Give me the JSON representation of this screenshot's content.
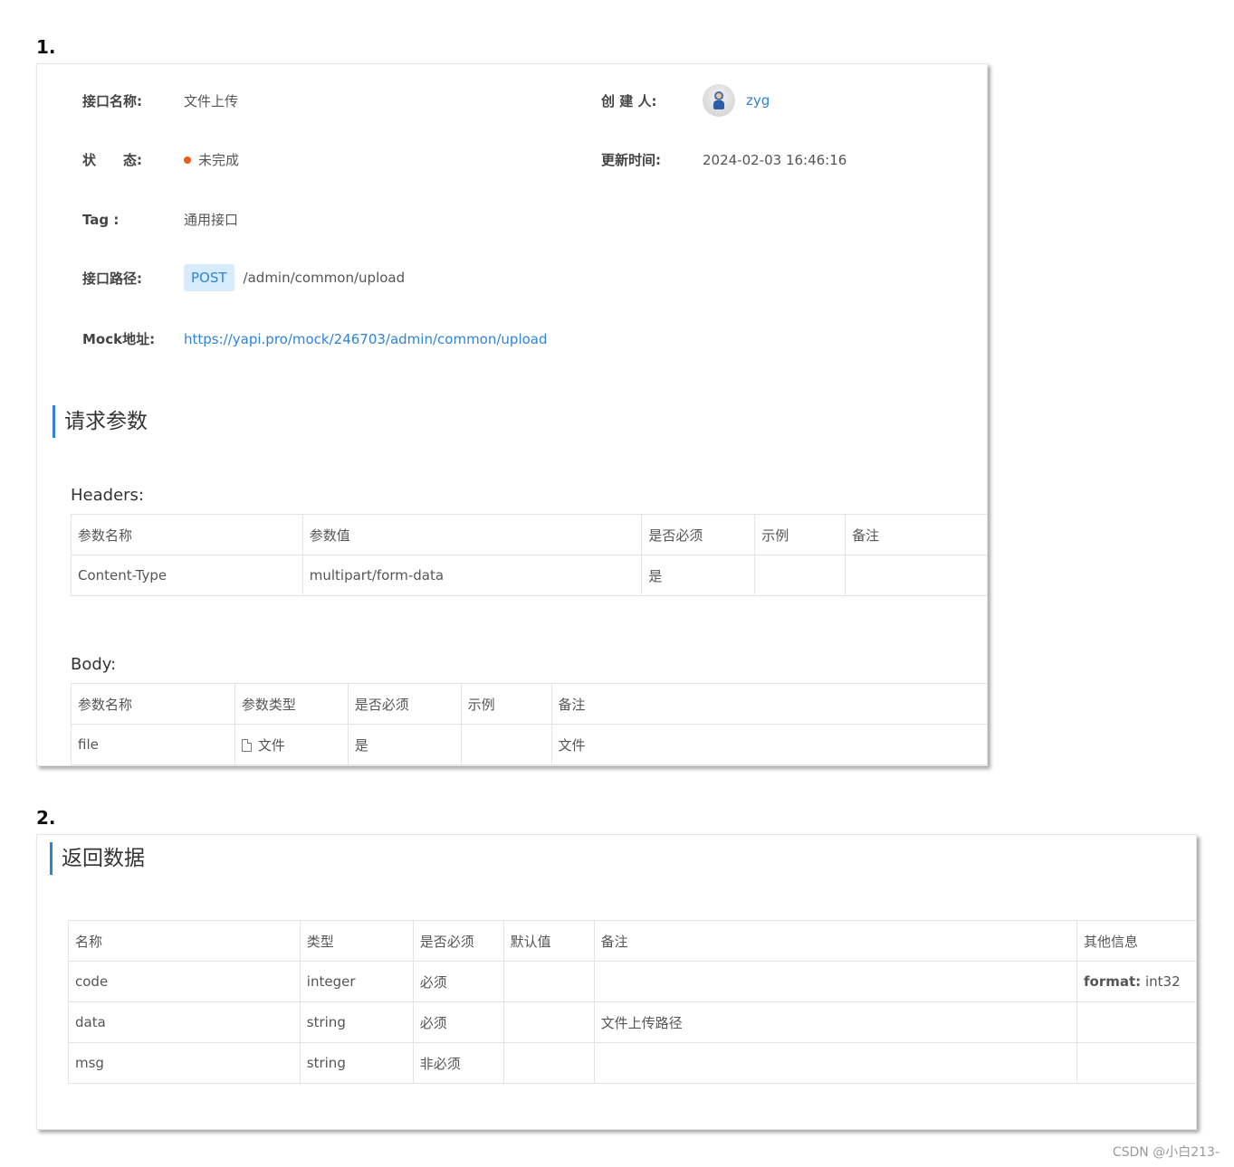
{
  "step1_label": "1.",
  "step2_label": "2.",
  "info": {
    "name_label": "接口名称:",
    "name_value": "文件上传",
    "creator_label": "创 建 人:",
    "creator_value": "zyg",
    "status_label": "状　　态:",
    "status_value": "未完成",
    "status_color": "#f35a1a",
    "updated_label": "更新时间:",
    "updated_value": "2024-02-03 16:46:16",
    "tag_label": "Tag :",
    "tag_value": "通用接口",
    "path_label": "接口路径:",
    "method": "POST",
    "path_value": "/admin/common/upload",
    "mock_label": "Mock地址:",
    "mock_url": "https://yapi.pro/mock/246703/admin/common/upload"
  },
  "request_title": "请求参数",
  "headers": {
    "title": "Headers:",
    "columns": [
      "参数名称",
      "参数值",
      "是否必须",
      "示例",
      "备注"
    ],
    "rows": [
      [
        "Content-Type",
        "multipart/form-data",
        "是",
        "",
        ""
      ]
    ]
  },
  "body": {
    "title": "Body:",
    "columns": [
      "参数名称",
      "参数类型",
      "是否必须",
      "示例",
      "备注"
    ],
    "rows": [
      [
        "file",
        "文件",
        "是",
        "",
        "文件"
      ]
    ]
  },
  "response_title": "返回数据",
  "response": {
    "columns": [
      "名称",
      "类型",
      "是否必须",
      "默认值",
      "备注",
      "其他信息"
    ],
    "rows": [
      [
        "code",
        "integer",
        "必须",
        "",
        "",
        "format:|int32"
      ],
      [
        "data",
        "string",
        "必须",
        "",
        "文件上传路径",
        ""
      ],
      [
        "msg",
        "string",
        "非必须",
        "",
        "",
        ""
      ]
    ]
  },
  "watermark": "CSDN @小白213-",
  "accent_color": "#2f83d8"
}
